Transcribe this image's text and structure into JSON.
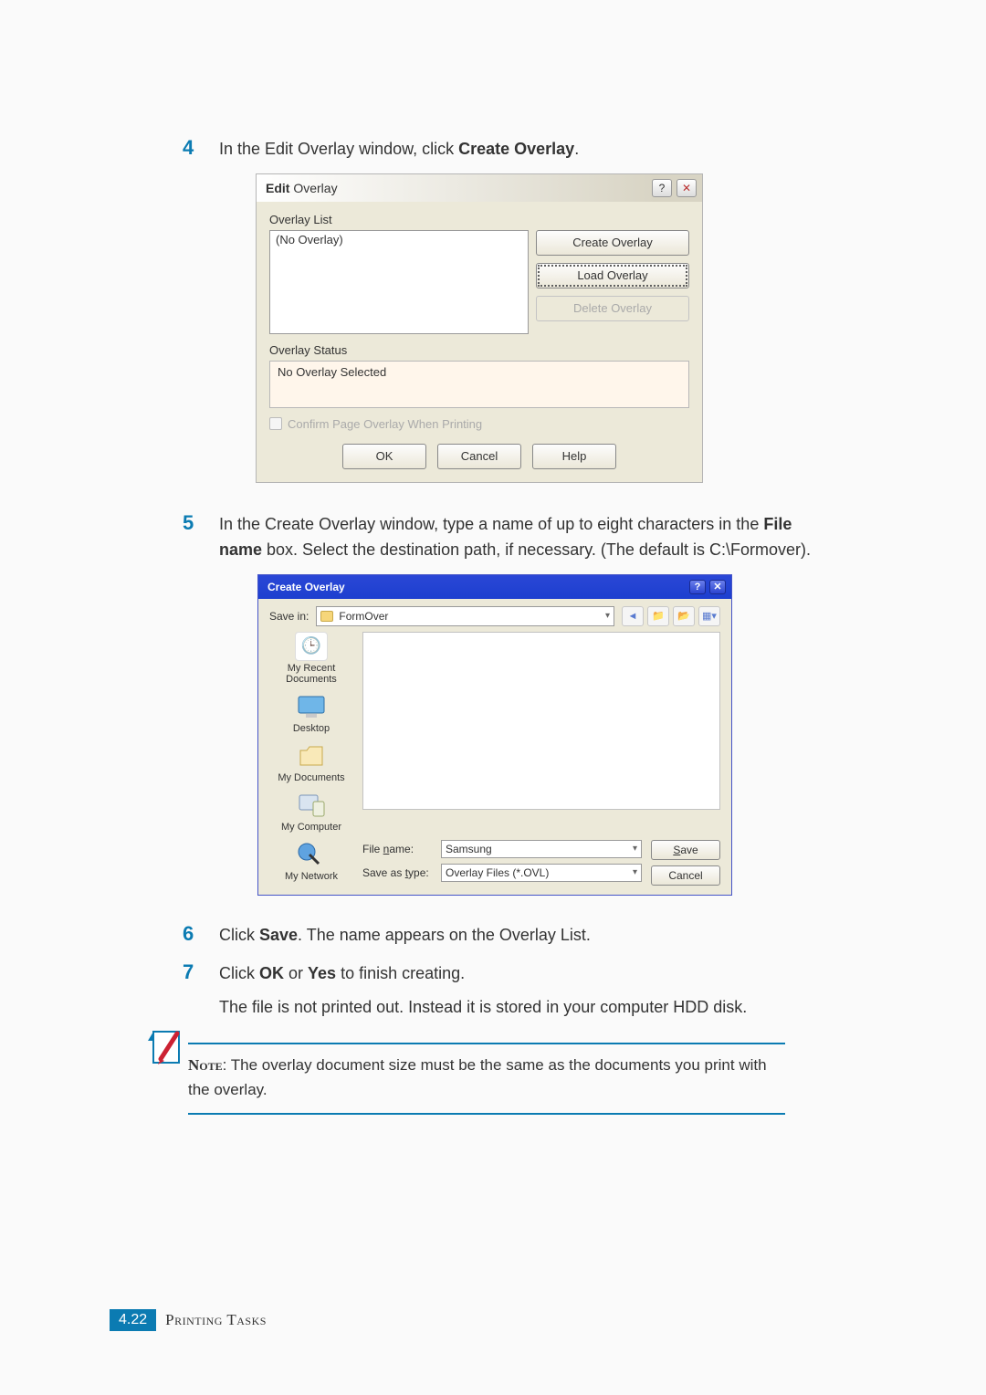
{
  "steps": {
    "s4": {
      "num": "4",
      "pre": "In the Edit Overlay window, click ",
      "bold": "Create Overlay",
      "post": "."
    },
    "s5": {
      "num": "5",
      "pre": "In the Create Overlay window, type a name of up to eight characters in the ",
      "bold": "File name",
      "post": " box. Select the destination path, if necessary. (The default is C:\\Formover)."
    },
    "s6": {
      "num": "6",
      "pre": "Click ",
      "bold": "Save",
      "post": ". The name appears on the Overlay List."
    },
    "s7": {
      "num": "7",
      "pre": "Click ",
      "bold1": "OK",
      "mid": " or ",
      "bold2": "Yes",
      "post": " to finish creating."
    }
  },
  "edit_dialog": {
    "title": "Edit Overlay",
    "overlay_list_label": "Overlay List",
    "list_item": "(No Overlay)",
    "buttons": {
      "create": "Create Overlay",
      "load": "Load Overlay",
      "delete": "Delete Overlay"
    },
    "status_label": "Overlay Status",
    "status_text": "No Overlay Selected",
    "confirm_label": "Confirm Page Overlay When Printing",
    "bottom": {
      "ok": "OK",
      "cancel": "Cancel",
      "help": "Help"
    }
  },
  "create_dialog": {
    "title": "Create Overlay",
    "save_in_label": "Save in:",
    "save_in_value": "FormOver",
    "side": {
      "recent": "My Recent Documents",
      "desktop": "Desktop",
      "docs": "My Documents",
      "computer": "My Computer",
      "network": "My Network"
    },
    "file_name_label": "File name:",
    "file_name_value": "Samsung",
    "save_as_type_label": "Save as type:",
    "save_as_type_value": "Overlay Files (*.OVL)",
    "actions": {
      "save": "Save",
      "cancel": "Cancel"
    }
  },
  "body_para": "The file is not printed out. Instead it is stored in your computer HDD disk.",
  "note": {
    "label": "Note",
    "text": ": The overlay document size must be the same as the documents you print with the overlay."
  },
  "footer": {
    "page": "4.22",
    "section": "Printing Tasks"
  }
}
